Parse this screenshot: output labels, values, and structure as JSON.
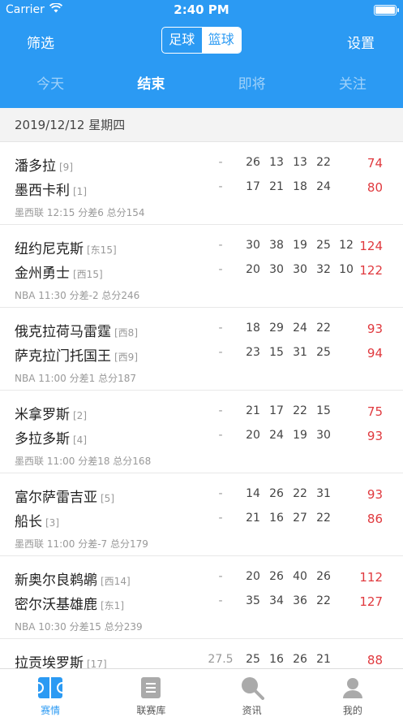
{
  "status": {
    "carrier": "Carrier",
    "time": "2:40 PM"
  },
  "nav": {
    "left": "筛选",
    "right": "设置",
    "segments": [
      "足球",
      "篮球"
    ],
    "active_segment": 1
  },
  "tabs": [
    "今天",
    "结束",
    "即将",
    "关注"
  ],
  "active_tab": 1,
  "date": "2019/12/12 星期四",
  "games": [
    {
      "home": {
        "name": "潘多拉",
        "rank": "[9]",
        "spread": "-",
        "quarters": [
          "26",
          "13",
          "13",
          "22",
          ""
        ],
        "total": "74"
      },
      "away": {
        "name": "墨西卡利",
        "rank": "[1]",
        "spread": "-",
        "quarters": [
          "17",
          "21",
          "18",
          "24",
          ""
        ],
        "total": "80"
      },
      "meta": "墨西联 12:15  分差6 总分154"
    },
    {
      "home": {
        "name": "纽约尼克斯",
        "rank": "[东15]",
        "spread": "-",
        "quarters": [
          "30",
          "38",
          "19",
          "25",
          "12"
        ],
        "total": "124"
      },
      "away": {
        "name": "金州勇士",
        "rank": "[西15]",
        "spread": "-",
        "quarters": [
          "20",
          "30",
          "30",
          "32",
          "10"
        ],
        "total": "122"
      },
      "meta": "NBA 11:30  分差-2 总分246"
    },
    {
      "home": {
        "name": "俄克拉荷马雷霆",
        "rank": "[西8]",
        "spread": "-",
        "quarters": [
          "18",
          "29",
          "24",
          "22",
          ""
        ],
        "total": "93"
      },
      "away": {
        "name": "萨克拉门托国王",
        "rank": "[西9]",
        "spread": "-",
        "quarters": [
          "23",
          "15",
          "31",
          "25",
          ""
        ],
        "total": "94"
      },
      "meta": "NBA 11:00  分差1 总分187"
    },
    {
      "home": {
        "name": "米拿罗斯",
        "rank": "[2]",
        "spread": "-",
        "quarters": [
          "21",
          "17",
          "22",
          "15",
          ""
        ],
        "total": "75"
      },
      "away": {
        "name": "多拉多斯",
        "rank": "[4]",
        "spread": "-",
        "quarters": [
          "20",
          "24",
          "19",
          "30",
          ""
        ],
        "total": "93"
      },
      "meta": "墨西联 11:00  分差18 总分168"
    },
    {
      "home": {
        "name": "富尔萨雷吉亚",
        "rank": "[5]",
        "spread": "-",
        "quarters": [
          "14",
          "26",
          "22",
          "31",
          ""
        ],
        "total": "93"
      },
      "away": {
        "name": "船长",
        "rank": "[3]",
        "spread": "-",
        "quarters": [
          "21",
          "16",
          "27",
          "22",
          ""
        ],
        "total": "86"
      },
      "meta": "墨西联 11:00  分差-7 总分179"
    },
    {
      "home": {
        "name": "新奥尔良鹈鹕",
        "rank": "[西14]",
        "spread": "-",
        "quarters": [
          "20",
          "26",
          "40",
          "26",
          ""
        ],
        "total": "112"
      },
      "away": {
        "name": "密尔沃基雄鹿",
        "rank": "[东1]",
        "spread": "-",
        "quarters": [
          "35",
          "34",
          "36",
          "22",
          ""
        ],
        "total": "127"
      },
      "meta": "NBA 10:30  分差15 总分239"
    },
    {
      "home": {
        "name": "拉贡埃罗斯",
        "rank": "[17]",
        "spread": "27.5",
        "quarters": [
          "25",
          "16",
          "26",
          "21",
          ""
        ],
        "total": "88"
      },
      "away": {
        "name": "",
        "rank": "",
        "spread": "",
        "quarters": [
          "",
          "",
          "",
          "",
          ""
        ],
        "total": ""
      },
      "meta": ""
    }
  ],
  "tabbar": [
    "赛情",
    "联赛库",
    "资讯",
    "我的"
  ],
  "tabbar_active": 0,
  "colors": {
    "accent": "#2b9af3",
    "score": "#e0393e"
  }
}
